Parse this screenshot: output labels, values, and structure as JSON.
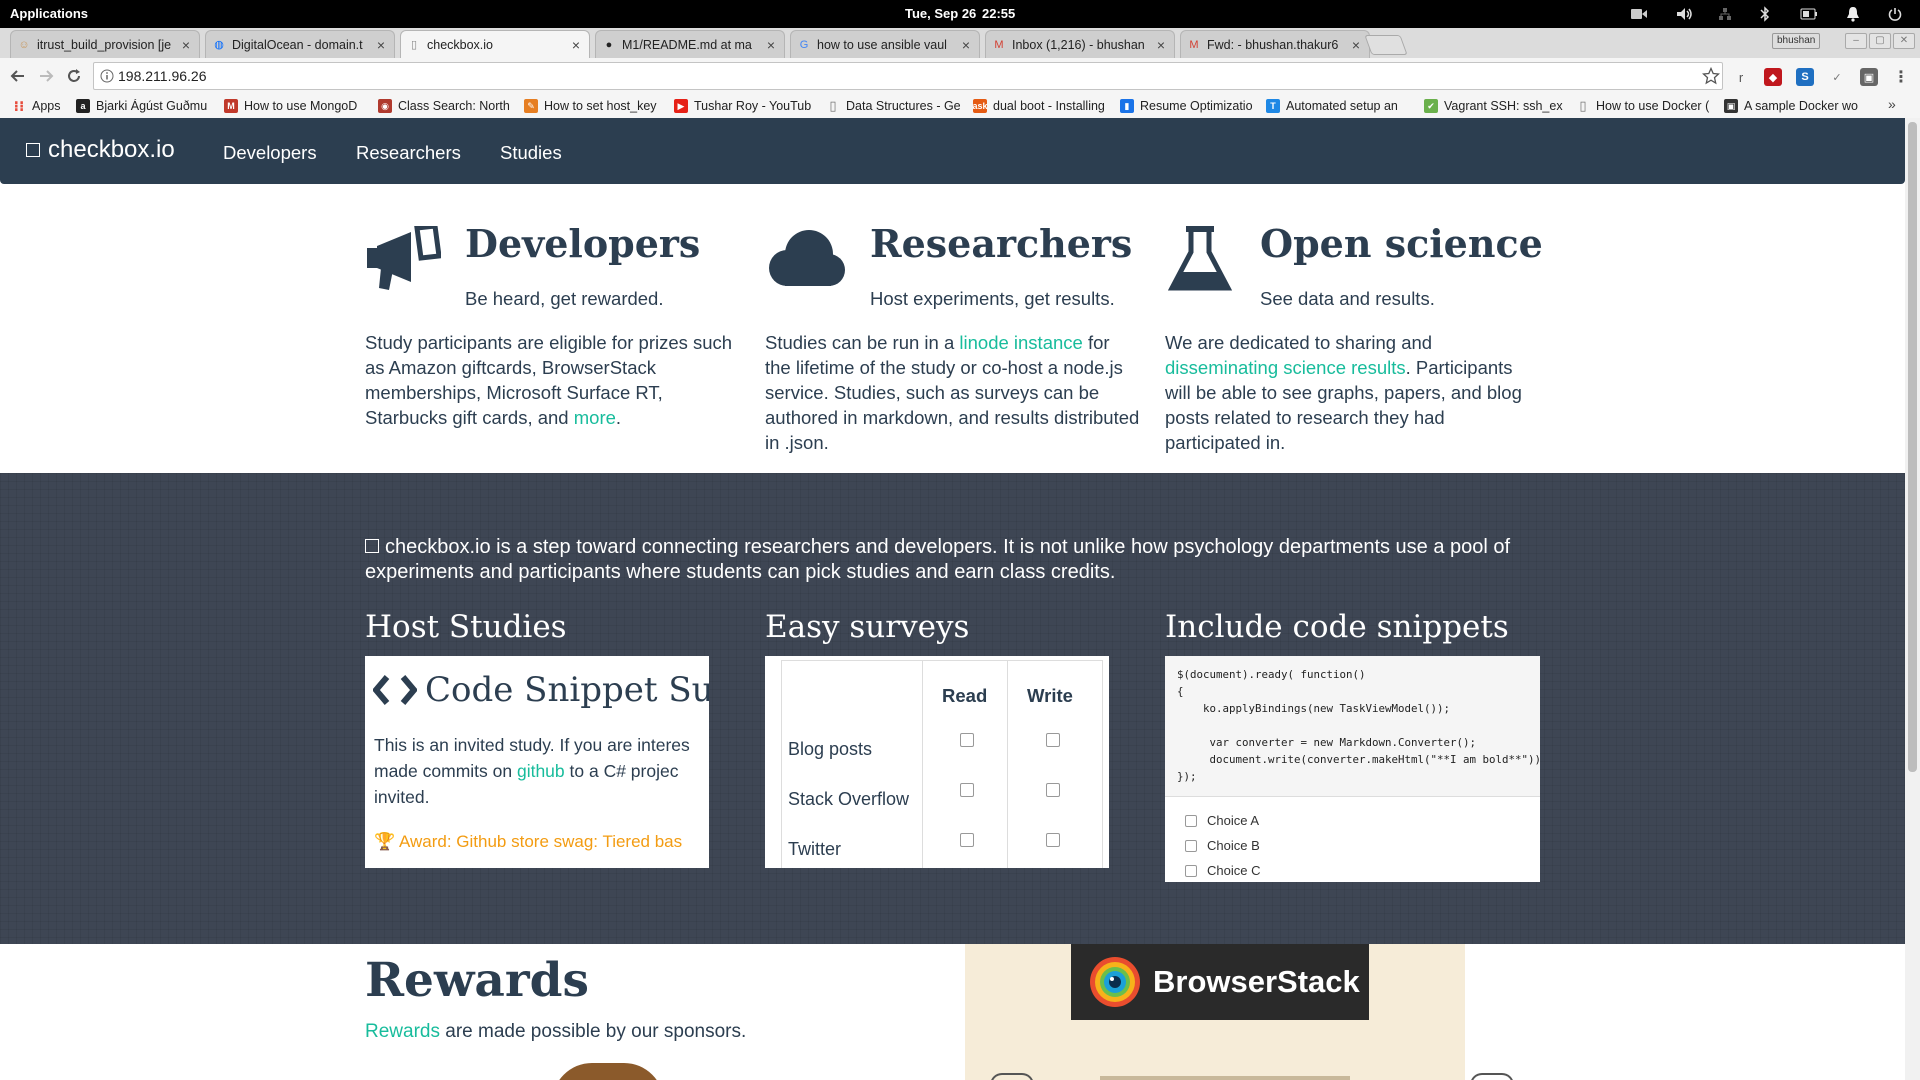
{
  "os": {
    "apps_label": "Applications",
    "date": "Tue, Sep 26",
    "time": "22:55"
  },
  "tabs": [
    {
      "label": "itrust_build_provision [je",
      "icon": "jenkins-icon"
    },
    {
      "label": "DigitalOcean - domain.t",
      "icon": "digitalocean-icon"
    },
    {
      "label": "checkbox.io",
      "icon": "page-icon"
    },
    {
      "label": "M1/README.md at ma",
      "icon": "github-icon"
    },
    {
      "label": "how to use ansible vaul",
      "icon": "google-icon"
    },
    {
      "label": "Inbox (1,216) - bhushan",
      "icon": "gmail-icon"
    },
    {
      "label": "Fwd: - bhushan.thakur6",
      "icon": "gmail-icon"
    }
  ],
  "profile_name": "bhushan",
  "url": "198.211.96.26",
  "bookmarks": [
    "Apps",
    "Bjarki Ágúst Guðmu",
    "How to use MongoD",
    "Class Search: North",
    "How to set host_key",
    "Tushar Roy - YouTub",
    "Data Structures - Ge",
    "dual boot - Installing",
    "Resume Optimizatio",
    "Automated setup an",
    "Vagrant SSH: ssh_ex",
    "How to use Docker (",
    "A sample Docker wo"
  ],
  "site": {
    "brand": "checkbox.io",
    "nav": [
      "Developers",
      "Researchers",
      "Studies"
    ],
    "features": [
      {
        "title": "Developers",
        "subtitle": "Be heard, get rewarded.",
        "body_before": "Study participants are eligible for prizes such as Amazon giftcards, BrowserStack memberships, Microsoft Surface RT, Starbucks gift cards, and ",
        "link": "more",
        "body_after": "."
      },
      {
        "title": "Researchers",
        "subtitle": "Host experiments, get results.",
        "body_before": "Studies can be run in a ",
        "link": "linode instance",
        "body_after": " for the lifetime of the study or co-host a node.js service. Studies, such as surveys can be authored in markdown, and results distributed in .json."
      },
      {
        "title": "Open science",
        "subtitle": "See data and results.",
        "body_before": "We are dedicated to sharing and ",
        "link": "disseminating science results",
        "body_after": ". Participants will be able to see graphs, papers, and blog posts related to research they had participated in."
      }
    ],
    "intro": "checkbox.io is a step toward connecting researchers and developers. It is not unlike how psychology departments use a pool of experiments and participants where students can pick studies and earn class credits.",
    "sections": [
      "Host Studies",
      "Easy surveys",
      "Include code snippets"
    ],
    "host_card": {
      "title": "Code Snippet Su",
      "body_before": "This is an invited study. If you are interes",
      "body_mid1": "made commits on ",
      "link": "github",
      "body_mid2": " to a C# projec",
      "body_end": "invited.",
      "award": "Award: Github store swag: Tiered bas"
    },
    "survey_card": {
      "headers": [
        "Read",
        "Write"
      ],
      "rows": [
        "Blog posts",
        "Stack Overflow",
        "Twitter"
      ]
    },
    "code_card": {
      "lines": [
        "$(document).ready( function()",
        "{",
        "    ko.applyBindings(new TaskViewModel());",
        "",
        "     var converter = new Markdown.Converter();",
        "     document.write(converter.makeHtml(\"**I am bold**\"));",
        "});"
      ],
      "choices": [
        "Choice A",
        "Choice B",
        "Choice C"
      ]
    },
    "rewards_title": "Rewards",
    "rewards_link": "Rewards",
    "rewards_text": " are made possible by our sponsors.",
    "sponsor": "BrowserStack"
  }
}
